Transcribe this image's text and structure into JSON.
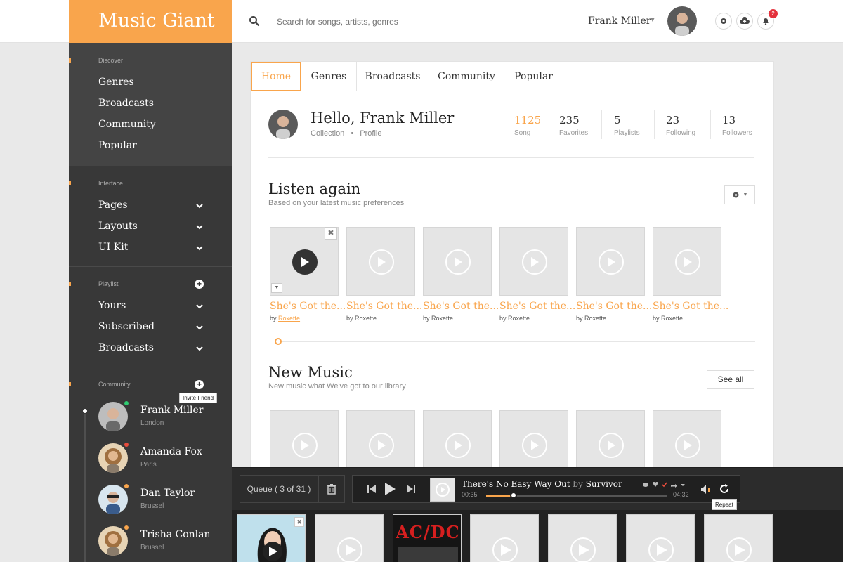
{
  "brand": {
    "title": "Music Giant",
    "color": "#f9a54c"
  },
  "search": {
    "placeholder": "Search for songs, artists, genres",
    "icon": "search-icon"
  },
  "header": {
    "user_name": "Frank Miller",
    "notifications_count": "2"
  },
  "sidebar": {
    "discover": {
      "label": "Discover",
      "items": [
        "Genres",
        "Broadcasts",
        "Community",
        "Popular"
      ]
    },
    "interface": {
      "label": "Interface",
      "items": [
        "Pages",
        "Layouts",
        "UI Kit"
      ]
    },
    "playlist": {
      "label": "Playlist",
      "items": [
        "Yours",
        "Subscribed",
        "Broadcasts"
      ]
    },
    "community": {
      "label": "Community",
      "invite_tooltip": "Invite Friend",
      "friends": [
        {
          "name": "Frank Miller",
          "city": "London",
          "status": "#2ecc71"
        },
        {
          "name": "Amanda Fox",
          "city": "Paris",
          "status": "#e74c3c"
        },
        {
          "name": "Dan Taylor",
          "city": "Brussel",
          "status": "#f9a54c"
        },
        {
          "name": "Trisha Conlan",
          "city": "Brussel",
          "status": "#f9a54c"
        }
      ]
    }
  },
  "tabs": [
    "Home",
    "Genres",
    "Broadcasts",
    "Community",
    "Popular"
  ],
  "profile": {
    "greeting": "Hello, Frank Miller",
    "link_collection": "Collection",
    "link_separator": "•",
    "link_profile": "Profile",
    "stats": [
      {
        "value": "1125",
        "label": "Song"
      },
      {
        "value": "235",
        "label": "Favorites"
      },
      {
        "value": "5",
        "label": "Playlists"
      },
      {
        "value": "23",
        "label": "Following"
      },
      {
        "value": "13",
        "label": "Followers"
      }
    ]
  },
  "listen_again": {
    "title": "Listen again",
    "subtitle": "Based on your latest music preferences",
    "tracks": [
      {
        "title": "She's Got the...",
        "by": "by",
        "artist": "Roxette"
      },
      {
        "title": "She's Got the...",
        "by": "by",
        "artist": "Roxette"
      },
      {
        "title": "She's Got the...",
        "by": "by",
        "artist": "Roxette"
      },
      {
        "title": "She's Got the...",
        "by": "by",
        "artist": "Roxette"
      },
      {
        "title": "She's Got the...",
        "by": "by",
        "artist": "Roxette"
      },
      {
        "title": "She's Got the...",
        "by": "by",
        "artist": "Roxette"
      }
    ]
  },
  "new_music": {
    "title": "New Music",
    "subtitle": "New music what We've got to our library",
    "see_all": "See all"
  },
  "player": {
    "queue_label": "Queue ( 3 of 31 )",
    "track": "There's No Easy Way Out",
    "by": "by",
    "artist": "Survivor",
    "elapsed": "00:35",
    "total": "04:32",
    "progress_fraction": 0.15,
    "repeat_tooltip": "Repeat"
  },
  "queue_strip": {
    "album_text": "AC/DC"
  }
}
